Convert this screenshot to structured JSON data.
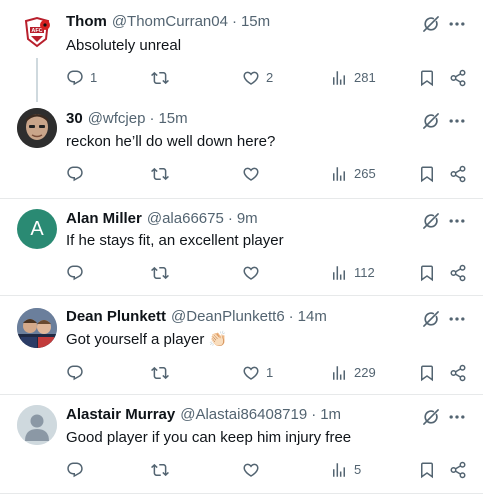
{
  "posts": [
    {
      "name": "Thom",
      "handle": "@ThomCurran04",
      "time": "15m",
      "text": "Absolutely unreal",
      "avatar": "club-crest-avatar",
      "replies": "1",
      "reposts": "",
      "likes": "2",
      "views": "281"
    },
    {
      "name": "30",
      "handle": "@wfcjep",
      "time": "15m",
      "text": "reckon he’ll do well down here?",
      "avatar": "photo-avatar",
      "replies": "",
      "reposts": "",
      "likes": "",
      "views": "265"
    },
    {
      "name": "Alan Miller",
      "handle": "@ala66675",
      "time": "9m",
      "text": "If he stays fit,  an excellent player",
      "avatar": "letter-avatar",
      "avatar_letter": "A",
      "replies": "",
      "reposts": "",
      "likes": "",
      "views": "112"
    },
    {
      "name": "Dean Plunkett",
      "handle": "@DeanPlunkett6",
      "time": "14m",
      "text": "Got yourself a player 👏🏻",
      "avatar": "photo-avatar",
      "replies": "",
      "reposts": "",
      "likes": "1",
      "views": "229"
    },
    {
      "name": "Alastair Murray",
      "handle": "@Alastai86408719",
      "time": "1m",
      "text": "Good player if you can keep him injury free",
      "avatar": "default-avatar",
      "replies": "",
      "reposts": "",
      "likes": "",
      "views": "5"
    }
  ],
  "separator": "·",
  "colors": {
    "text": "#0f1419",
    "secondary": "#536471",
    "divider": "#e7e9ea",
    "letter_avatar_bg": "#2a8a73"
  },
  "icons": [
    "reply-icon",
    "repost-icon",
    "like-icon",
    "views-icon",
    "bookmark-icon",
    "share-icon",
    "grok-icon",
    "more-icon"
  ]
}
